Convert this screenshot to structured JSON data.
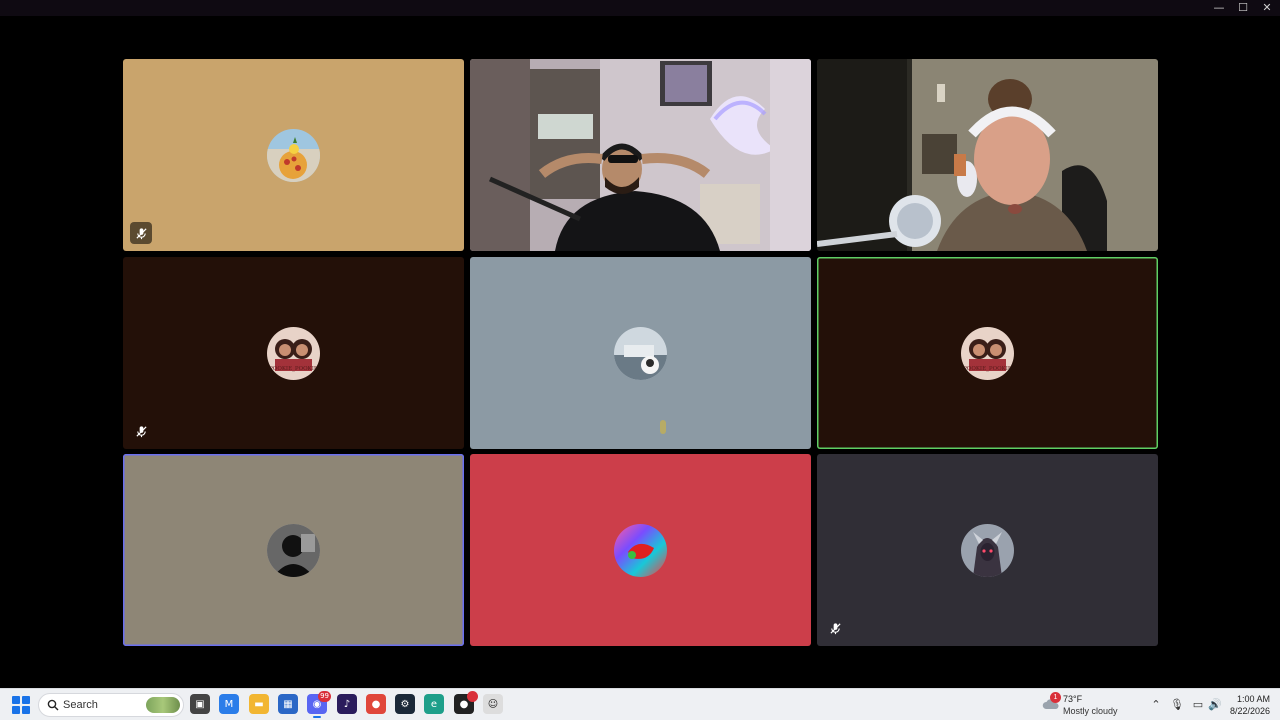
{
  "window": {
    "controls": {
      "minimize": "—",
      "maximize": "☐",
      "close": "✕"
    }
  },
  "participants": [
    {
      "id": "p1",
      "type": "avatar",
      "bg": "#c9a46c",
      "muted": true
    },
    {
      "id": "p2",
      "type": "video",
      "scene": "man-headset"
    },
    {
      "id": "p3",
      "type": "video",
      "scene": "woman-headphones"
    },
    {
      "id": "p4",
      "type": "avatar",
      "bg": "#231008",
      "muted": true,
      "avatar_text": "POOKIE_POOKIE"
    },
    {
      "id": "p5",
      "type": "avatar",
      "bg": "#8c9aa4",
      "muted": false
    },
    {
      "id": "p6",
      "type": "avatar",
      "bg": "#231008",
      "muted": false,
      "speaking": true,
      "avatar_text": "POOKIE_POOKIE"
    },
    {
      "id": "p7",
      "type": "avatar",
      "bg": "#8e8676",
      "muted": false,
      "selected": true
    },
    {
      "id": "p8",
      "type": "avatar",
      "bg": "#cc3e4a",
      "muted": false
    },
    {
      "id": "p9",
      "type": "avatar",
      "bg": "#302e36",
      "muted": true
    }
  ],
  "taskbar": {
    "search_label": "Search",
    "apps": [
      {
        "name": "task-view",
        "glyph": "▣",
        "color": "#444"
      },
      {
        "name": "msn",
        "glyph": "M",
        "color": "#2b7de9"
      },
      {
        "name": "file-explorer",
        "glyph": "▬",
        "color": "#f2b632"
      },
      {
        "name": "microsoft-store",
        "glyph": "▦",
        "color": "#2b67c6"
      },
      {
        "name": "discord",
        "glyph": "◉",
        "color": "#5865f2",
        "badge": "99",
        "active": true
      },
      {
        "name": "amazon-music",
        "glyph": "♪",
        "color": "#2a1c5c"
      },
      {
        "name": "chrome",
        "glyph": "●",
        "color": "#e0463a"
      },
      {
        "name": "steam",
        "glyph": "⚙",
        "color": "#1b2838"
      },
      {
        "name": "edge",
        "glyph": "e",
        "color": "#1e9f8a"
      },
      {
        "name": "media-player",
        "glyph": "●",
        "color": "#222",
        "badge": " "
      },
      {
        "name": "tux",
        "glyph": "☺",
        "color": "#ddd"
      }
    ],
    "weather": {
      "temp": "73°F",
      "desc": "Mostly cloudy",
      "badge": "1"
    },
    "tray": {
      "chevron": "⌃",
      "mic": "🎙",
      "display": "▭",
      "volume": "🔊"
    },
    "clock": {
      "time": "1:00 AM",
      "date": "8/22/2026"
    }
  }
}
